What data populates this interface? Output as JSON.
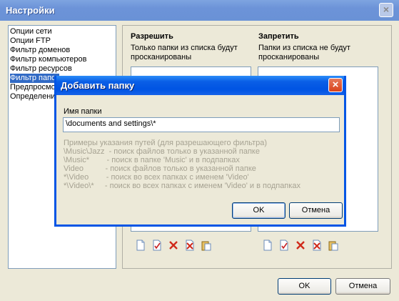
{
  "window": {
    "title": "Настройки"
  },
  "sidebar": {
    "items": [
      {
        "label": "Опции сети"
      },
      {
        "label": "Опции FTP"
      },
      {
        "label": "Фильтр доменов"
      },
      {
        "label": "Фильтр компьютеров"
      },
      {
        "label": "Фильтр ресурсов"
      },
      {
        "label": "Фильтр папок"
      },
      {
        "label": "Предпросмотр"
      },
      {
        "label": "Определение"
      }
    ]
  },
  "allow": {
    "header": "Разрешить",
    "desc_line1": "Только папки из списка будут",
    "desc_line2": "просканированы"
  },
  "deny": {
    "header": "Запретить",
    "desc_line1": "Папки из списка не будут",
    "desc_line2": "просканированы"
  },
  "toolbar_icons": [
    "new-icon",
    "edit-icon",
    "delete-icon",
    "clear-icon",
    "paste-icon"
  ],
  "footer": {
    "ok_label": "OK",
    "cancel_label": "Отмена"
  },
  "dialog": {
    "title": "Добавить папку",
    "field_label": "Имя папки",
    "field_value": "\\documents and settings\\*",
    "examples": [
      "Примеры указания путей (для разрешающего фильтра)",
      "\\Music\\Jazz  - поиск файлов только в указанной папке",
      "\\Music*        - поиск в папке 'Music' и в подпапках",
      "Video          - поиск файлов только в указанной папке",
      "*\\Video        - поиск во всех папках с именем 'Video'",
      "*\\Video\\*     - поиск во всех папках с именем 'Video' и в подпапках"
    ],
    "ok_label": "OK",
    "cancel_label": "Отмена"
  },
  "colors": {
    "selection": "#316AC5",
    "dialog_title": "#0054E3",
    "face": "#ECE9D8"
  }
}
